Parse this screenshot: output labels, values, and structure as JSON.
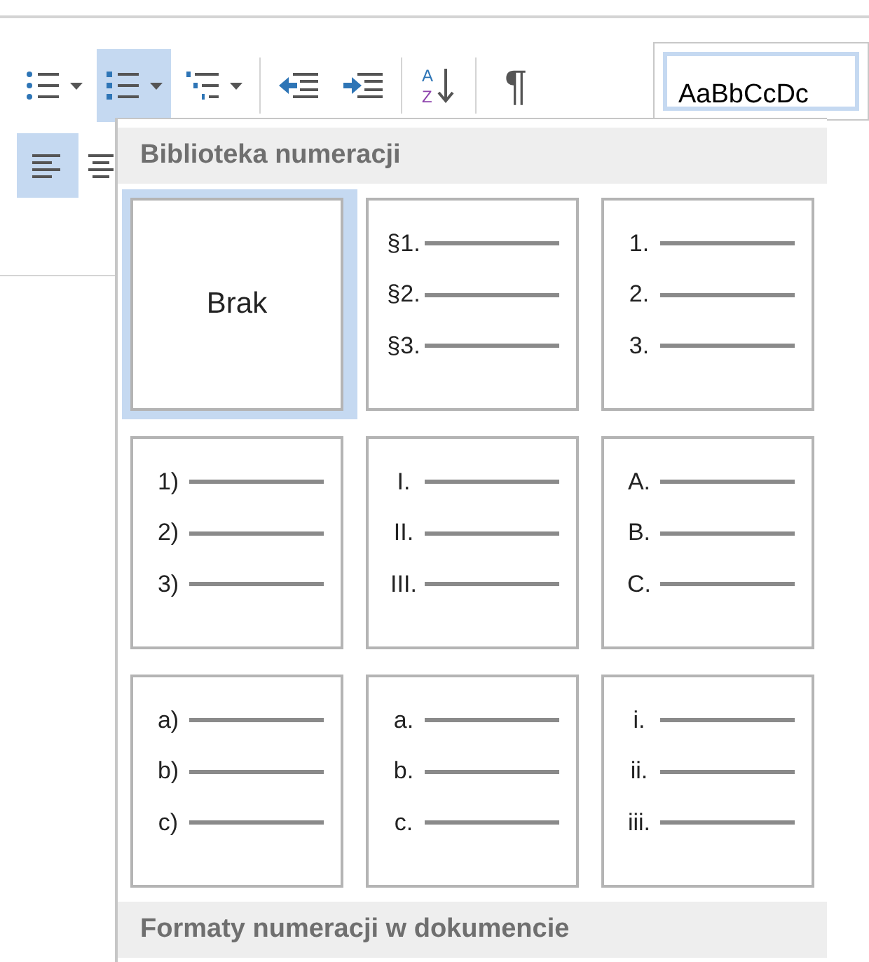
{
  "toolbar": {
    "row_1": [
      {
        "kind": "bullets",
        "selected": false
      },
      {
        "kind": "numbering",
        "selected": true
      },
      {
        "kind": "multilevel",
        "selected": false
      },
      {
        "kind": "outdent",
        "selected": false
      },
      {
        "kind": "indent",
        "selected": false
      },
      {
        "kind": "sort",
        "letters": [
          "A",
          "Z"
        ],
        "selected": false
      },
      {
        "kind": "pilcrow",
        "label": "¶",
        "selected": false
      }
    ],
    "row_2": [
      {
        "kind": "align-left",
        "selected": true
      },
      {
        "kind": "align-center",
        "selected": false
      }
    ],
    "styles_gallery": {
      "sample": "AaBbCcDc"
    }
  },
  "numbering_menu": {
    "sections": [
      {
        "title": "Biblioteka numeracji"
      },
      {
        "title": "Formaty numeracji w dokumencie"
      }
    ],
    "tiles": [
      {
        "kind": "none",
        "label": "Brak",
        "selected": true
      },
      {
        "kind": "list",
        "markers": [
          "§1.",
          "§2.",
          "§3."
        ],
        "selected": false
      },
      {
        "kind": "list",
        "markers": [
          "1.",
          "2.",
          "3."
        ],
        "selected": false
      },
      {
        "kind": "list",
        "markers": [
          "1)",
          "2)",
          "3)"
        ],
        "selected": false
      },
      {
        "kind": "list",
        "markers": [
          "I.",
          "II.",
          "III."
        ],
        "selected": false
      },
      {
        "kind": "list",
        "markers": [
          "A.",
          "B.",
          "C."
        ],
        "selected": false
      },
      {
        "kind": "list",
        "markers": [
          "a)",
          "b)",
          "c)"
        ],
        "selected": false
      },
      {
        "kind": "list",
        "markers": [
          "a.",
          "b.",
          "c."
        ],
        "selected": false
      },
      {
        "kind": "list",
        "markers": [
          "i.",
          "ii.",
          "iii."
        ],
        "selected": false
      }
    ]
  }
}
